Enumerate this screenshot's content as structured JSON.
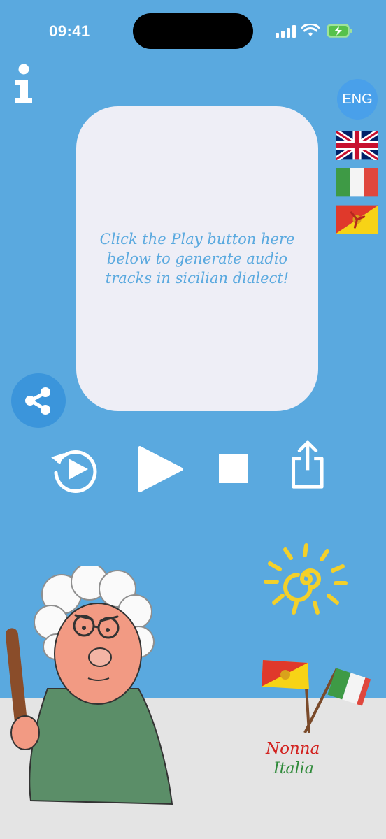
{
  "status_bar": {
    "time": "09:41"
  },
  "language": {
    "current": "ENG"
  },
  "message": {
    "text": "Click the Play button here below to generate audio tracks in sicilian dialect!"
  },
  "branding": {
    "line1": "Nonna",
    "line2": "Italia"
  },
  "colors": {
    "background": "#5aa9df",
    "card": "#eeeef6",
    "accent_blue": "#3b95db",
    "ground": "#e4e4e4",
    "sun": "#f3d02a",
    "brand_red": "#d2221f",
    "brand_green": "#2f8a3a"
  },
  "icons": [
    "info-icon",
    "share-icon",
    "replay-icon",
    "play-icon",
    "stop-icon",
    "export-icon",
    "uk-flag",
    "italy-flag",
    "sicily-flag",
    "sun-icon"
  ]
}
